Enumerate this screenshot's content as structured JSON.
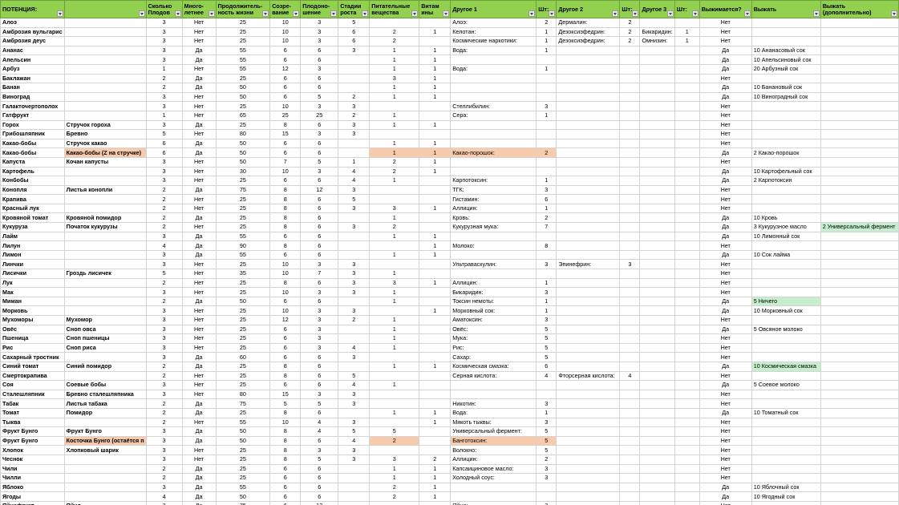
{
  "columns": [
    "ПОТЕНЦИЯ:",
    "",
    "Сколько Плодов",
    "Много-летнее",
    "Продолжитель-ность жизни",
    "Созре-вание",
    "Плодоно-шение",
    "Стадии роста",
    "Питательные вещества",
    "Витам ины",
    "Другое 1",
    "Шт:",
    "Другое 2",
    "Шт:",
    "Другое 3",
    "Шт:",
    "Выжимается?",
    "Выжать",
    "Выжать (дополнительно)"
  ],
  "highlight_colors": {
    "orange": "#f8cbad",
    "green": "#c6efce",
    "header": "#92d050"
  },
  "rows": [
    [
      "Алоэ",
      "",
      "3",
      "Нет",
      "25",
      "10",
      "3",
      "5",
      "",
      "",
      "Алоэ:",
      "2",
      "Дермалин:",
      "2",
      "",
      "",
      "Нет",
      "",
      ""
    ],
    [
      "Амброзия вульгарис",
      "",
      "3",
      "Нет",
      "25",
      "10",
      "3",
      "6",
      "2",
      "1",
      "Келотан:",
      "1",
      "Дезоксиэфедрин:",
      "2",
      "Бикаридин:",
      "1",
      "Нет",
      "",
      ""
    ],
    [
      "Амброзия деус",
      "",
      "3",
      "Нет",
      "25",
      "10",
      "3",
      "6",
      "2",
      "",
      "Космические наркотики:",
      "1",
      "Дезоксиэфедрин:",
      "2",
      "Омнизин:",
      "1",
      "Нет",
      "",
      ""
    ],
    [
      "Ананас",
      "",
      "3",
      "Да",
      "55",
      "6",
      "6",
      "3",
      "1",
      "1",
      "Вода:",
      "1",
      "",
      "",
      "",
      "",
      "Да",
      "10 Ананасовый сок",
      ""
    ],
    [
      "Апельсин",
      "",
      "3",
      "Да",
      "55",
      "6",
      "6",
      "",
      "1",
      "1",
      "",
      "",
      "",
      "",
      "",
      "",
      "Да",
      "10 Апельсиновый сок",
      ""
    ],
    [
      "Арбуз",
      "",
      "1",
      "Нет",
      "55",
      "12",
      "3",
      "",
      "1",
      "1",
      "Вода:",
      "1",
      "",
      "",
      "",
      "",
      "Да",
      "20 Арбузный сок",
      ""
    ],
    [
      "Баклажан",
      "",
      "2",
      "Да",
      "25",
      "6",
      "6",
      "",
      "3",
      "1",
      "",
      "",
      "",
      "",
      "",
      "",
      "Нет",
      "",
      ""
    ],
    [
      "Банан",
      "",
      "2",
      "Да",
      "50",
      "6",
      "6",
      "",
      "1",
      "1",
      "",
      "",
      "",
      "",
      "",
      "",
      "Да",
      "10 Банановый сок",
      ""
    ],
    [
      "Виноград",
      "",
      "3",
      "Нет",
      "50",
      "6",
      "5",
      "2",
      "1",
      "1",
      "",
      "",
      "",
      "",
      "",
      "",
      "Да",
      "10 Виноградный сок",
      ""
    ],
    [
      "Галакточертополох",
      "",
      "3",
      "Нет",
      "25",
      "10",
      "3",
      "3",
      "",
      "",
      "Стеллибилин:",
      "3",
      "",
      "",
      "",
      "",
      "Нет",
      "",
      ""
    ],
    [
      "Гатфрукт",
      "",
      "1",
      "Нет",
      "65",
      "25",
      "25",
      "2",
      "1",
      "",
      "Сера:",
      "1",
      "",
      "",
      "",
      "",
      "Нет",
      "",
      ""
    ],
    [
      "Горох",
      "Стручок гороха",
      "3",
      "Да",
      "25",
      "8",
      "6",
      "3",
      "1",
      "1",
      "",
      "",
      "",
      "",
      "",
      "",
      "Нет",
      "",
      ""
    ],
    [
      "Грибошляпник",
      "Бревно",
      "5",
      "Нет",
      "80",
      "15",
      "3",
      "3",
      "",
      "",
      "",
      "",
      "",
      "",
      "",
      "",
      "Нет",
      "",
      ""
    ],
    [
      "Какао-бобы",
      "Стручок какао",
      "6",
      "Да",
      "50",
      "6",
      "6",
      "",
      "1",
      "1",
      "",
      "",
      "",
      "",
      "",
      "",
      "Нет",
      "",
      ""
    ],
    [
      "Какао-бобы",
      "Какао-бобы (Z на стручке)",
      "6",
      "Да",
      "50",
      "6",
      "6",
      "",
      "1",
      "1",
      "Какао-порошок:",
      "2",
      "",
      "",
      "",
      "",
      "Да",
      "2 Какао-порошок",
      ""
    ],
    [
      "Капуста",
      "Кочан капусты",
      "3",
      "Нет",
      "50",
      "7",
      "5",
      "1",
      "2",
      "1",
      "",
      "",
      "",
      "",
      "",
      "",
      "Нет",
      "",
      ""
    ],
    [
      "Картофель",
      "",
      "3",
      "Нет",
      "30",
      "10",
      "3",
      "4",
      "2",
      "1",
      "",
      "",
      "",
      "",
      "",
      "",
      "Да",
      "10 Картофельный сок",
      ""
    ],
    [
      "Конбобы",
      "",
      "3",
      "Нет",
      "25",
      "6",
      "6",
      "4",
      "1",
      "",
      "Карпотоксин:",
      "1",
      "",
      "",
      "",
      "",
      "Да",
      "2 Карпотоксин",
      ""
    ],
    [
      "Конопля",
      "Листья конопли",
      "2",
      "Да",
      "75",
      "8",
      "12",
      "3",
      "",
      "",
      "ТГК:",
      "3",
      "",
      "",
      "",
      "",
      "Нет",
      "",
      ""
    ],
    [
      "Крапива",
      "",
      "2",
      "Нет",
      "25",
      "8",
      "6",
      "5",
      "",
      "",
      "Гистамин:",
      "6",
      "",
      "",
      "",
      "",
      "Нет",
      "",
      ""
    ],
    [
      "Красный лук",
      "",
      "2",
      "Нет",
      "25",
      "8",
      "6",
      "3",
      "3",
      "1",
      "Аллицин:",
      "1",
      "",
      "",
      "",
      "",
      "Нет",
      "",
      ""
    ],
    [
      "Кровяной томат",
      "Кровяной помидор",
      "2",
      "Да",
      "25",
      "8",
      "6",
      "",
      "1",
      "",
      "Кровь:",
      "2",
      "",
      "",
      "",
      "",
      "Да",
      "10 Кровь",
      ""
    ],
    [
      "Кукуруза",
      "Початок кукурузы",
      "2",
      "Нет",
      "25",
      "8",
      "6",
      "3",
      "2",
      "",
      "Кукурузная мука:",
      "7",
      "",
      "",
      "",
      "",
      "Да",
      "3 Кукурузное масло",
      "2 Универсальный фермент"
    ],
    [
      "Лайм",
      "",
      "3",
      "Да",
      "55",
      "6",
      "6",
      "",
      "1",
      "1",
      "",
      "",
      "",
      "",
      "",
      "",
      "Да",
      "10 Лимонный сок",
      ""
    ],
    [
      "Лилун",
      "",
      "4",
      "Да",
      "90",
      "8",
      "6",
      "",
      "",
      "1",
      "Молоко:",
      "8",
      "",
      "",
      "",
      "",
      "Нет",
      "",
      ""
    ],
    [
      "Лимон",
      "",
      "3",
      "Да",
      "55",
      "6",
      "6",
      "",
      "1",
      "1",
      "",
      "",
      "",
      "",
      "",
      "",
      "Да",
      "10 Сок лайма",
      ""
    ],
    [
      "Линчки",
      "",
      "3",
      "Нет",
      "25",
      "10",
      "3",
      "3",
      "",
      "",
      "Ультраваскулин:",
      "3",
      "Эпинефрин:",
      "3",
      "",
      "",
      "Нет",
      "",
      ""
    ],
    [
      "Лисички",
      "Гроздь лисичек",
      "5",
      "Нет",
      "35",
      "10",
      "7",
      "3",
      "1",
      "",
      "",
      "",
      "",
      "",
      "",
      "",
      "Нет",
      "",
      ""
    ],
    [
      "Лук",
      "",
      "2",
      "Нет",
      "25",
      "8",
      "6",
      "3",
      "3",
      "1",
      "Аллицин:",
      "1",
      "",
      "",
      "",
      "",
      "Нет",
      "",
      ""
    ],
    [
      "Мак",
      "",
      "3",
      "Нет",
      "25",
      "10",
      "3",
      "3",
      "1",
      "",
      "Бикаридин:",
      "3",
      "",
      "",
      "",
      "",
      "Нет",
      "",
      ""
    ],
    [
      "Миман",
      "",
      "2",
      "Да",
      "50",
      "6",
      "6",
      "",
      "1",
      "",
      "Токсин немоты:",
      "1",
      "",
      "",
      "",
      "",
      "Да",
      "5 Ничего",
      ""
    ],
    [
      "Морковь",
      "",
      "3",
      "Нет",
      "25",
      "10",
      "3",
      "3",
      "",
      "1",
      "Морковный сок:",
      "1",
      "",
      "",
      "",
      "",
      "Да",
      "10 Морковный сок",
      ""
    ],
    [
      "Мухоморы",
      "Мухомор",
      "3",
      "Нет",
      "25",
      "12",
      "3",
      "2",
      "1",
      "",
      "Аматоксин:",
      "3",
      "",
      "",
      "",
      "",
      "Нет",
      "",
      ""
    ],
    [
      "Овёс",
      "Сноп овса",
      "3",
      "Нет",
      "25",
      "6",
      "3",
      "",
      "1",
      "",
      "Овёс:",
      "5",
      "",
      "",
      "",
      "",
      "Да",
      "5 Овсяное молоко",
      ""
    ],
    [
      "Пшеница",
      "Сноп пшеницы",
      "3",
      "Нет",
      "25",
      "6",
      "3",
      "",
      "1",
      "",
      "Мука:",
      "5",
      "",
      "",
      "",
      "",
      "Нет",
      "",
      ""
    ],
    [
      "Рис",
      "Сноп риса",
      "3",
      "Нет",
      "25",
      "6",
      "3",
      "4",
      "1",
      "",
      "Рис:",
      "5",
      "",
      "",
      "",
      "",
      "Нет",
      "",
      ""
    ],
    [
      "Сахарный тростник",
      "",
      "3",
      "Да",
      "60",
      "6",
      "6",
      "3",
      "",
      "",
      "Сахар:",
      "5",
      "",
      "",
      "",
      "",
      "Нет",
      "",
      ""
    ],
    [
      "Синий томат",
      "Синий помидор",
      "2",
      "Да",
      "25",
      "8",
      "6",
      "",
      "1",
      "1",
      "Космическая смазка:",
      "6",
      "",
      "",
      "",
      "",
      "Да",
      "10 Космическая смазка",
      ""
    ],
    [
      "Смертокрапива",
      "",
      "2",
      "Нет",
      "25",
      "8",
      "6",
      "5",
      "",
      "",
      "Серная кислота:",
      "4",
      "Фторсерная кислота:",
      "4",
      "",
      "",
      "Нет",
      "",
      ""
    ],
    [
      "Соя",
      "Соевые бобы",
      "3",
      "Нет",
      "25",
      "6",
      "6",
      "4",
      "1",
      "",
      "",
      "",
      "",
      "",
      "",
      "",
      "Да",
      "5 Соевое молоко",
      ""
    ],
    [
      "Сталешляпник",
      "Бревно сталешляпника",
      "3",
      "Нет",
      "80",
      "15",
      "3",
      "3",
      "",
      "",
      "",
      "",
      "",
      "",
      "",
      "",
      "Нет",
      "",
      ""
    ],
    [
      "Табак",
      "Листья табака",
      "2",
      "Да",
      "75",
      "5",
      "5",
      "3",
      "",
      "",
      "Никотин:",
      "3",
      "",
      "",
      "",
      "",
      "Нет",
      "",
      ""
    ],
    [
      "Томат",
      "Помидор",
      "2",
      "Да",
      "25",
      "8",
      "6",
      "",
      "1",
      "1",
      "Вода:",
      "1",
      "",
      "",
      "",
      "",
      "Да",
      "10 Томатный сок",
      ""
    ],
    [
      "Тыква",
      "",
      "2",
      "Нет",
      "55",
      "10",
      "4",
      "3",
      "",
      "1",
      "Мякоть тыквы:",
      "3",
      "",
      "",
      "",
      "",
      "Нет",
      "",
      ""
    ],
    [
      "Фрукт Бунго",
      "Фрукт Бунго",
      "3",
      "Да",
      "50",
      "8",
      "4",
      "5",
      "5",
      "",
      "Универсальный фермент:",
      "5",
      "",
      "",
      "",
      "",
      "Нет",
      "",
      ""
    ],
    [
      "Фрукт Бунго",
      "Косточка Бунго (остаётся п",
      "3",
      "Да",
      "50",
      "8",
      "6",
      "4",
      "2",
      "",
      "Банготоксин:",
      "5",
      "",
      "",
      "",
      "",
      "Нет",
      "",
      ""
    ],
    [
      "Хлопок",
      "Хлопковый шарик",
      "3",
      "Нет",
      "25",
      "8",
      "3",
      "3",
      "",
      "",
      "Волокно:",
      "5",
      "",
      "",
      "",
      "",
      "Нет",
      "",
      ""
    ],
    [
      "Чеснок",
      "",
      "3",
      "Нет",
      "25",
      "8",
      "5",
      "3",
      "3",
      "2",
      "Аллицин:",
      "2",
      "",
      "",
      "",
      "",
      "Нет",
      "",
      ""
    ],
    [
      "Чили",
      "",
      "2",
      "Да",
      "25",
      "6",
      "6",
      "",
      "1",
      "1",
      "Капсаициновое масло:",
      "3",
      "",
      "",
      "",
      "",
      "Нет",
      "",
      ""
    ],
    [
      "Чилли",
      "",
      "2",
      "Да",
      "25",
      "6",
      "6",
      "",
      "1",
      "1",
      "Холодный соус:",
      "3",
      "",
      "",
      "",
      "",
      "Нет",
      "",
      ""
    ],
    [
      "Яблоко",
      "",
      "3",
      "Да",
      "55",
      "6",
      "6",
      "",
      "2",
      "1",
      "",
      "",
      "",
      "",
      "",
      "",
      "Да",
      "10 Яблочный сок",
      ""
    ],
    [
      "Ягоды",
      "",
      "4",
      "Да",
      "50",
      "6",
      "6",
      "",
      "2",
      "1",
      "",
      "",
      "",
      "",
      "",
      "",
      "Да",
      "10 Ягодный сок",
      ""
    ],
    [
      "Яйцефрукт",
      "Яйцо",
      "2",
      "Да",
      "75",
      "6",
      "12",
      "",
      "",
      "",
      "Яйцо:",
      "3",
      "",
      "",
      "",
      "",
      "Нет",
      "",
      ""
    ]
  ],
  "highlights": [
    {
      "row": 14,
      "cols": [
        1,
        8,
        9,
        10,
        11
      ],
      "color": "orange"
    },
    {
      "row": 45,
      "cols": [
        1,
        8,
        10,
        11
      ],
      "color": "orange"
    },
    {
      "row": 22,
      "cols": [
        18
      ],
      "color": "green"
    },
    {
      "row": 30,
      "cols": [
        17
      ],
      "color": "green"
    },
    {
      "row": 37,
      "cols": [
        17
      ],
      "color": "green"
    }
  ]
}
